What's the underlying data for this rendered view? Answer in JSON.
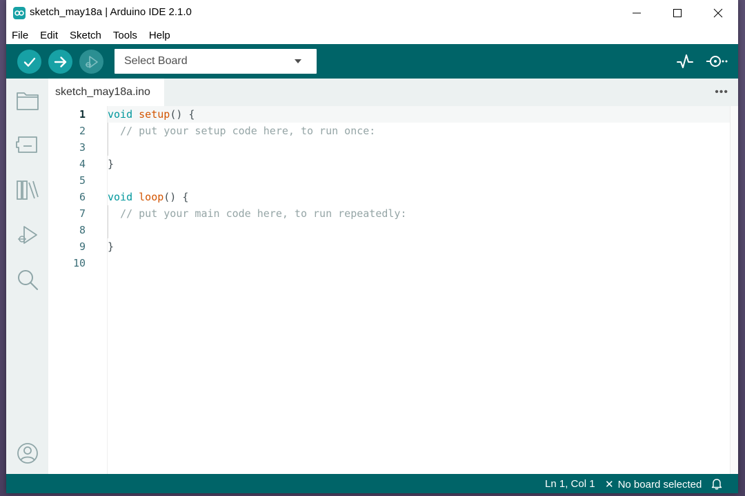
{
  "window": {
    "title": "sketch_may18a | Arduino IDE 2.1.0"
  },
  "menu": [
    "File",
    "Edit",
    "Sketch",
    "Tools",
    "Help"
  ],
  "toolbar": {
    "board_select_label": "Select Board"
  },
  "tabs": [
    {
      "label": "sketch_may18a.ino"
    }
  ],
  "editor": {
    "lines": [
      {
        "number": "1",
        "active": true
      },
      {
        "number": "2"
      },
      {
        "number": "3"
      },
      {
        "number": "4"
      },
      {
        "number": "5"
      },
      {
        "number": "6"
      },
      {
        "number": "7"
      },
      {
        "number": "8"
      },
      {
        "number": "9"
      },
      {
        "number": "10"
      }
    ],
    "code": {
      "l1_kw": "void",
      "l1_fn": "setup",
      "l1_rest": "() {",
      "l2_comment": "// put your setup code here, to run once:",
      "l4": "}",
      "l6_kw": "void",
      "l6_fn": "loop",
      "l6_rest": "() {",
      "l7_comment": "// put your main code here, to run repeatedly:",
      "l9": "}"
    }
  },
  "status": {
    "cursor_position": "Ln 1, Col 1",
    "board_status": "No board selected"
  },
  "colors": {
    "toolbar": "#006468",
    "button": "#17a1a5",
    "keyword": "#00979c",
    "function": "#d35400",
    "comment": "#95a5a6"
  }
}
